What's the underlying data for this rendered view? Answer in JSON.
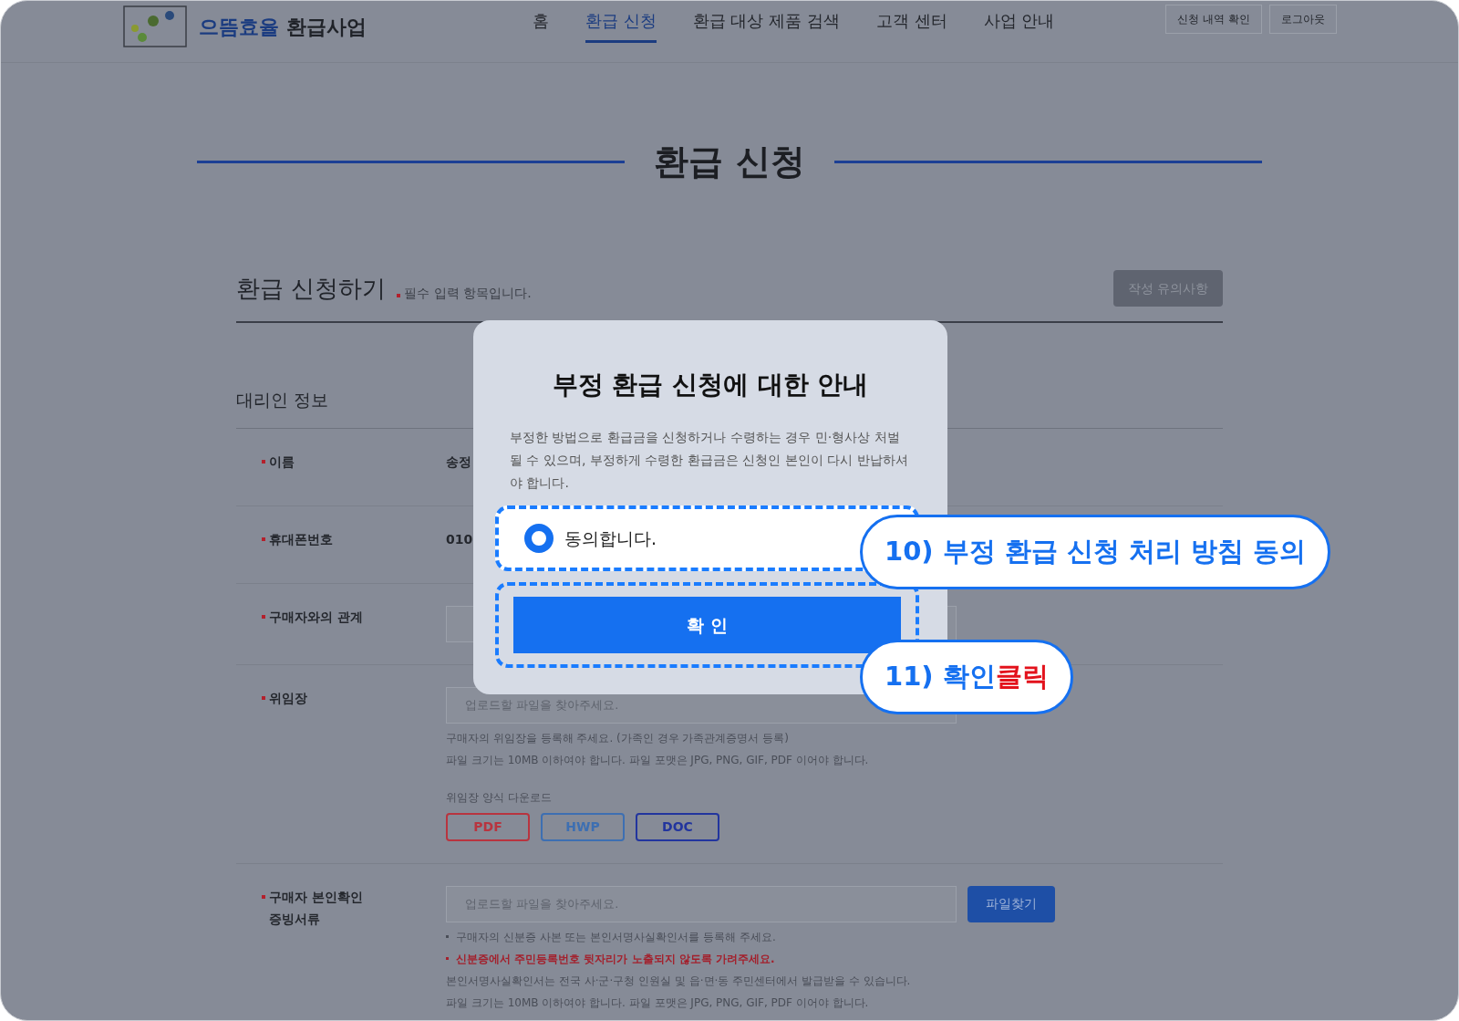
{
  "nav": {
    "logo_primary": "으뜸효율",
    "logo_secondary": "환급사업",
    "items": [
      {
        "label": "홈",
        "selected": false
      },
      {
        "label": "환급 신청",
        "selected": true
      },
      {
        "label": "환급 대상 제품 검색",
        "selected": false
      },
      {
        "label": "고객 센터",
        "selected": false
      },
      {
        "label": "사업 안내",
        "selected": false
      }
    ],
    "buttons": [
      "신청 내역 확인",
      "로그아웃"
    ]
  },
  "page_title": "환급 신청",
  "form": {
    "title": "환급 신청하기",
    "required_note": "필수 입력 항목입니다.",
    "notes_button": "작성 유의사항",
    "section": "대리인 정보",
    "rows": [
      {
        "kind": "text",
        "label": "이름",
        "value": "송정"
      },
      {
        "kind": "text",
        "label": "휴대폰번호",
        "value": "010"
      },
      {
        "kind": "select",
        "label": "구매자와의 관계"
      },
      {
        "kind": "file",
        "label": "위임장",
        "placeholder": "업로드할 파일을 찾아주세요.",
        "help": [
          "구매자의 위임장을 등록해 주세요. (가족인 경우 가족관계증명서 등록)",
          "파일 크기는 10MB 이하여야 합니다. 파일 포맷은 JPG, PNG, GIF, PDF 이어야 합니다."
        ],
        "download_label": "위임장 양식 다운로드",
        "downloads": [
          {
            "label": "PDF",
            "color": "#b8343f"
          },
          {
            "label": "HWP",
            "color": "#3d6fb2"
          },
          {
            "label": "DOC",
            "color": "#22359e"
          }
        ]
      },
      {
        "kind": "upload",
        "label": "구매자 본인확인 증빙서류",
        "placeholder": "업로드할 파일을 찾아주세요.",
        "button": "파일찾기",
        "notes": [
          {
            "kind": "bullet",
            "text": "구매자의 신분증 사본 또는 본인서명사실확인서를 등록해 주세요."
          },
          {
            "kind": "warning",
            "text": "신분증에서 주민등록번호 뒷자리가 노출되지 않도록 가려주세요."
          },
          {
            "kind": "plain",
            "text": "본인서명사실확인서는 전국 사·군·구청 인원실 및 읍·면·동 주민센터에서 발급받을 수 있습니다."
          },
          {
            "kind": "plain",
            "text": "파일 크기는 10MB 이하여야 합니다. 파일 포맷은 JPG, PNG, GIF, PDF 이어야 합니다."
          }
        ]
      }
    ]
  },
  "modal": {
    "title": "부정 환급 신청에 대한 안내",
    "body": "부정한 방법으로 환급금을 신청하거나 수령하는 경우 민·형사상 처벌될 수 있으며, 부정하게 수령한 환급금은 신청인 본인이 다시 반납하셔야 합니다.",
    "agree": {
      "label": "동의합니다.",
      "selected": true
    },
    "confirm": "확 인"
  },
  "callouts": [
    {
      "number": "10)",
      "text": "부정 환급 신청 처리 방침 동의"
    },
    {
      "number": "11)",
      "text": "확인",
      "emphasis": "클릭"
    }
  ]
}
